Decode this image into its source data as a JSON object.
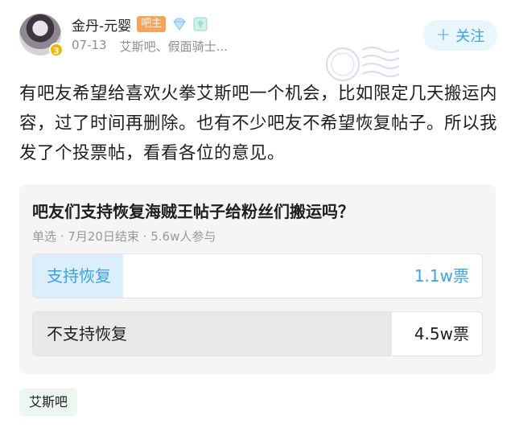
{
  "author": {
    "name": "金丹-元婴",
    "badge": "吧主",
    "level": "3",
    "date": "07-13",
    "source": "艾斯吧、假面骑士..."
  },
  "follow_button": {
    "plus": "+",
    "label": "关注"
  },
  "post": {
    "text": "有吧友希望给喜欢火拳艾斯吧一个机会，比如限定几天搬运内容，过了时间再删除。也有不少吧友不希望恢复帖子。所以我发了个投票帖，看看各位的意见。"
  },
  "vote": {
    "title": "吧友们支持恢复海贼王帖子给粉丝们搬运吗？",
    "meta": "单选 · 7月20日结束 · 5.6w人参与",
    "options": [
      {
        "label": "支持恢复",
        "count": "1.1w票",
        "share": 0.2
      },
      {
        "label": "不支持恢复",
        "count": "4.5w票",
        "share": 0.8
      }
    ]
  },
  "forum_tag": "艾斯吧",
  "colors": {
    "accent": "#3aa4e6",
    "badge": "#f6a35c",
    "tag_bg": "#edf6ef"
  },
  "icons": [
    "avatar",
    "diamond-icon",
    "level-icon",
    "plus-icon",
    "watermark-stamp"
  ]
}
